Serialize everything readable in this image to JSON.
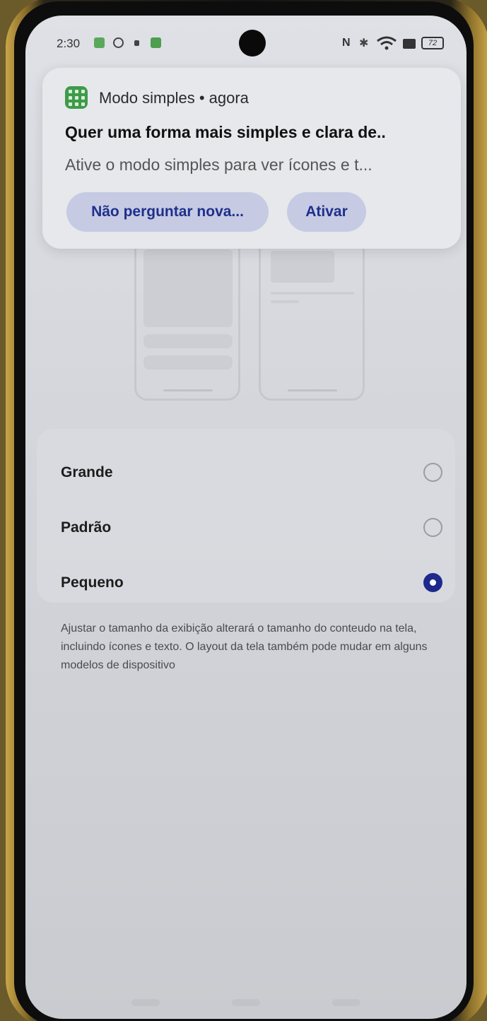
{
  "status_bar": {
    "time": "2:30",
    "nfc": "N",
    "battery": "72"
  },
  "notification": {
    "app_name": "Modo simples • agora",
    "title": "Quer uma forma mais simples e clara de..",
    "text": "Ative o modo simples para ver ícones e t...",
    "btn_dismiss": "Não perguntar nova...",
    "btn_enable": "Ativar",
    "accent": "#1f2f8c"
  },
  "options": [
    {
      "label": "Grande",
      "selected": false
    },
    {
      "label": "Padrão",
      "selected": false
    },
    {
      "label": "Pequeno",
      "selected": true
    }
  ],
  "description": "Ajustar o tamanho da exibição alterará o tamanho do conteudo na tela, incluindo ícones e texto. O layout da tela também pode mudar em alguns modelos de dispositivo"
}
